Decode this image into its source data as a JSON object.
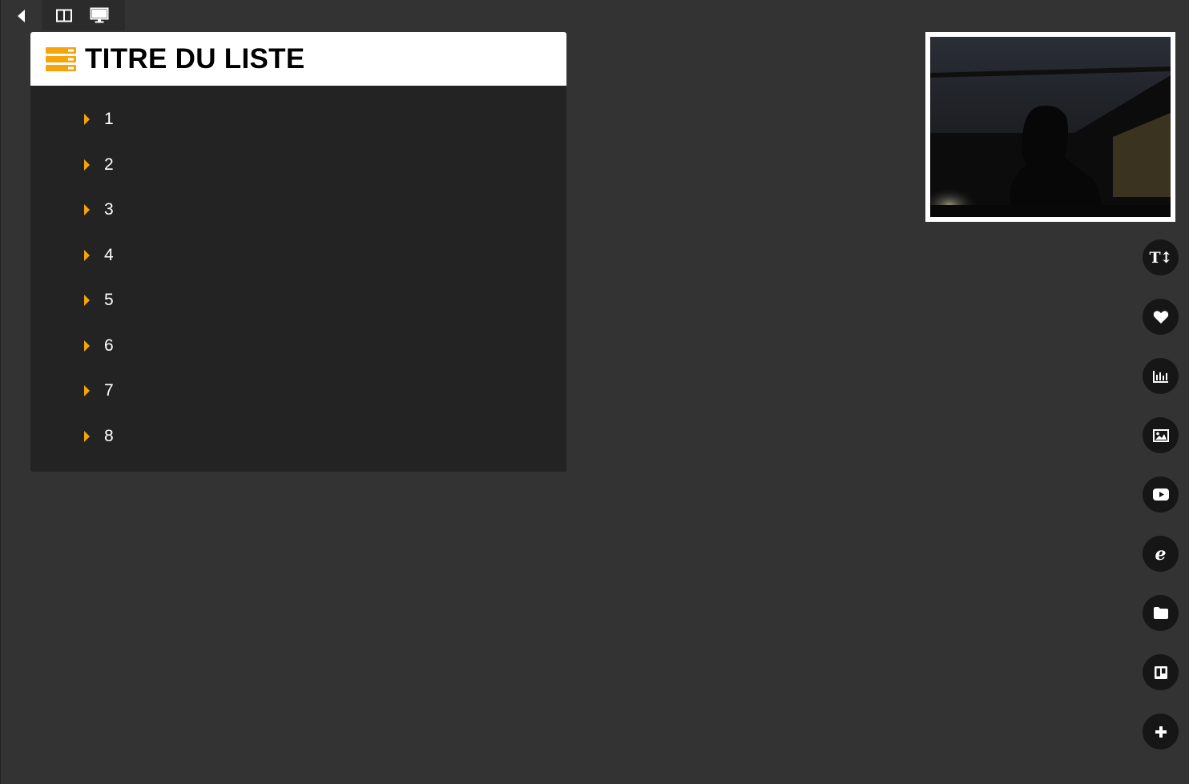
{
  "toolbar": {
    "icons": [
      "back-arrow-icon",
      "split-view-icon",
      "monitor-icon"
    ]
  },
  "panel": {
    "title": "TITRE DU LISTE",
    "icon": "list-icon",
    "accent_color": "#f7a30b",
    "items": [
      {
        "label": "1"
      },
      {
        "label": "2"
      },
      {
        "label": "3"
      },
      {
        "label": "4"
      },
      {
        "label": "5"
      },
      {
        "label": "6"
      },
      {
        "label": "7"
      },
      {
        "label": "8"
      }
    ]
  },
  "webcam": {
    "icon": "webcam-preview"
  },
  "side_buttons": [
    {
      "icon": "text-size-icon",
      "glyph": "T↕"
    },
    {
      "icon": "heart-icon"
    },
    {
      "icon": "bar-chart-icon"
    },
    {
      "icon": "image-icon"
    },
    {
      "icon": "youtube-icon"
    },
    {
      "icon": "internet-explorer-icon",
      "glyph": "e"
    },
    {
      "icon": "folder-icon"
    },
    {
      "icon": "trello-icon"
    },
    {
      "icon": "plus-icon"
    }
  ]
}
